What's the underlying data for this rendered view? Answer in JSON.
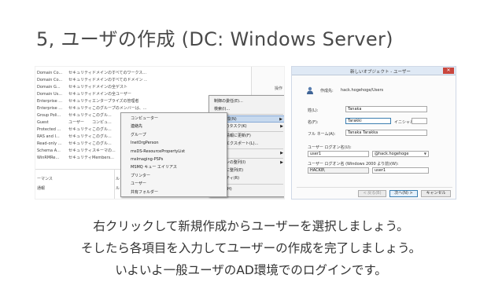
{
  "slide": {
    "title": "5, ユーザの作成 (DC: Windows Server)",
    "caption_lines": [
      "右クリックして新規作成からユーザーを選択しましょう。",
      "そしたら各項目を入力してユーザーの作成を完了しましょう。",
      "いよいよ一般ユーザのAD環境でのログインです。"
    ]
  },
  "left_screenshot": {
    "rows": [
      [
        "Domain Co...",
        "セキュリティ グル...",
        "ドメインのすべてのワークス..."
      ],
      [
        "Domain Co...",
        "セキュリティ グル...",
        "ドメインのすべてのドメイン ..."
      ],
      [
        "Domain G...",
        "セキュリティ グル...",
        "ドメインの全ゲスト"
      ],
      [
        "Domain Us...",
        "セキュリティ グル...",
        "ドメインの全ユーザー"
      ],
      [
        "Enterprise ...",
        "セキュリティ グル...",
        "エンタープライズの管理者"
      ],
      [
        "Enterprise ...",
        "セキュリティ グル...",
        "このグループのメンバーは、..."
      ],
      [
        "Group Poli...",
        "セキュリティ グル...",
        "このグル..."
      ],
      [
        "Guest",
        "ユーザー",
        "コンピュ..."
      ],
      [
        "Protected ...",
        "セキュリティ グル...",
        "このグル..."
      ],
      [
        "RAS and I...",
        "セキュリティ グル...",
        "このグル..."
      ],
      [
        "Read-only ...",
        "セキュリティ グル...",
        "このグル..."
      ],
      [
        "Schema A...",
        "セキュリティ グル...",
        "スキーマの..."
      ],
      [
        "WinRMRe...",
        "セキュリティ グル...",
        "Members..."
      ]
    ],
    "right_panel_header": "操作",
    "bottom_panel": [
      "ーマンス",
      "通報",
      "ル",
      "ル"
    ],
    "context_menu": [
      {
        "label": "制御の委任(E)...",
        "arrow": false,
        "highlight": false
      },
      {
        "label": "検索(I)...",
        "arrow": false,
        "highlight": false
      },
      {
        "label": "新規作成(N)",
        "arrow": true,
        "highlight": true
      },
      {
        "label": "すべてのタスク(K)",
        "arrow": true,
        "highlight": false
      },
      {
        "label": "最新の情報に更新(F)",
        "arrow": false,
        "highlight": false
      },
      {
        "label": "一覧のエクスポート(L)...",
        "arrow": false,
        "highlight": false
      },
      {
        "label": "表示(V)",
        "arrow": true,
        "highlight": false
      },
      {
        "label": "アイコンの整列(I)",
        "arrow": true,
        "highlight": false
      },
      {
        "label": "等間隔に整列(E)",
        "arrow": false,
        "highlight": false
      },
      {
        "label": "プロパティ(R)",
        "arrow": false,
        "highlight": false
      },
      {
        "label": "ヘルプ(H)",
        "arrow": false,
        "highlight": false
      }
    ],
    "sub_menu": [
      "コンピューター",
      "連絡先",
      "グループ",
      "InetOrgPerson",
      "msDS-ResourcePropertyList",
      "msImaging-PSPs",
      "MSMQ キュー エイリアス",
      "プリンター",
      "ユーザー",
      "共有フォルダー"
    ]
  },
  "right_screenshot": {
    "title": "新しいオブジェクト - ユーザー",
    "close_glyph": "✕",
    "create_in_label": "作成先:",
    "create_in_value": "hack.hogehoge/Users",
    "last_name_label": "姓(L):",
    "last_name_value": "Tanaka",
    "first_name_label": "名(F):",
    "first_name_value": "Tarakki",
    "initials_label": "イニシャル",
    "initials_value": "",
    "full_name_label": "フル ネーム(A):",
    "full_name_value": "Tanaka Tarakka",
    "logon_name_label": "ユーザー ログオン名(U):",
    "logon_name_value": "user1",
    "domain_value": "@hack.hogehoge",
    "pre2000_label": "ユーザー ログオン名 (Windows 2000 より前)(W):",
    "pre2000_domain": "HACK8\\",
    "pre2000_user": "user1",
    "back_button": "< 戻る(B)",
    "next_button": "次へ(N) >",
    "cancel_button": "キャンセル"
  }
}
